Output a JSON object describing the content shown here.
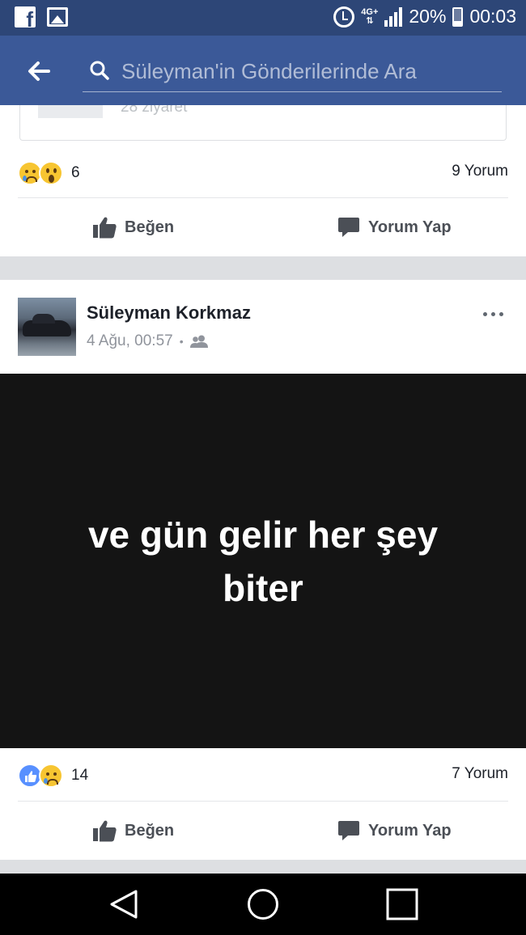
{
  "status_bar": {
    "icons": [
      "facebook-icon",
      "gallery-icon",
      "alarm-icon",
      "network-4g-icon",
      "signal-icon",
      "battery-icon"
    ],
    "network": "4G+",
    "battery": "20%",
    "time": "00:03"
  },
  "header": {
    "back_icon": "arrow-left-icon",
    "search_icon": "search-icon",
    "search_placeholder": "Süleyman'in Gönderilerinde Ara",
    "search_value": ""
  },
  "previous_post": {
    "link_card_visits": "28 ziyaret",
    "reactions": [
      "sad",
      "wow"
    ],
    "reaction_count": "6",
    "comment_count": "9 Yorum",
    "like_label": "Beğen",
    "comment_label": "Yorum Yap"
  },
  "post": {
    "author": "Süleyman Korkmaz",
    "time": "4 Ağu, 00:57",
    "separator": "•",
    "audience_icon": "friends-icon",
    "text": "ve gün gelir her şey biter",
    "reactions": [
      "like",
      "sad"
    ],
    "reaction_count": "14",
    "comment_count": "7 Yorum",
    "like_label": "Beğen",
    "comment_label": "Yorum Yap"
  },
  "nav_bar": {
    "buttons": [
      "back-triangle-icon",
      "home-circle-icon",
      "recents-square-icon"
    ]
  },
  "colors": {
    "status_bar": "#2d4677",
    "header": "#3b5998",
    "text_post_bg": "#141414",
    "action_text": "#4b4f56",
    "like_reaction": "#5890ff",
    "emoji_yellow": "#f7c531"
  }
}
